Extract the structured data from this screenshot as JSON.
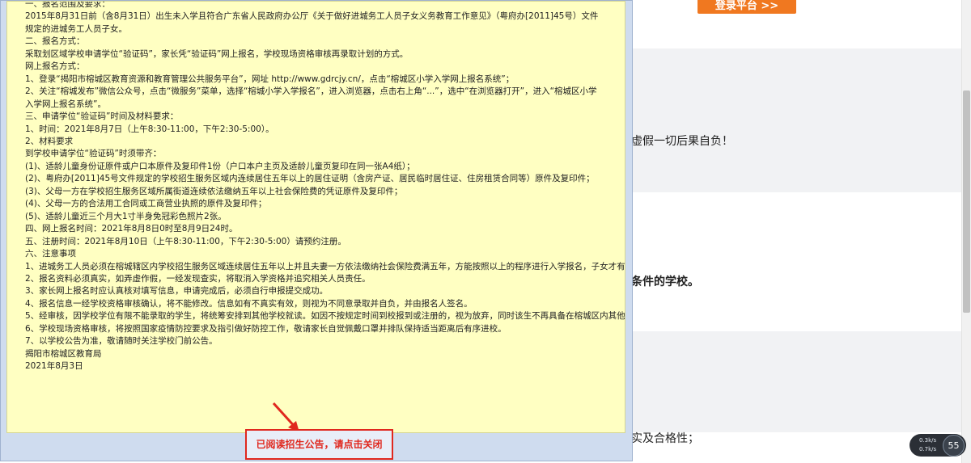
{
  "background": {
    "login_label": "登录平台 >>",
    "text1": "虚假一切后果自负！",
    "text2": "条件的学校。",
    "text3": "实及合格性；",
    "widget": {
      "line1": "0.3k/s",
      "line2": "0.7k/s",
      "value": "55"
    }
  },
  "notice": {
    "lines": [
      "一、报名范围及要求：",
      "2015年8月31日前（含8月31日）出生未入学且符合广东省人民政府办公厅《关于做好进城务工人员子女义务教育工作意见》（粤府办[2011]45号）文件",
      "规定的进城务工人员子女。",
      "二、报名方式：",
      "采取划区域学校申请学位“验证码”，家长凭“验证码”网上报名，学校现场资格审核再录取计划的方式。",
      "网上报名方式：",
      "1、登录“揭阳市榕城区教育资源和教育管理公共服务平台”，网址 http://www.gdrcjy.cn/，点击“榕城区小学入学网上报名系统”；",
      "2、关注“榕城发布”微信公众号，点击“微服务”菜单，选择“榕城小学入学报名”，进入浏览器，点击右上角“...”，选中“在浏览器打开”，进入“榕城区小学",
      "入学网上报名系统”。",
      "三、申请学位“验证码”时间及材料要求：",
      "1、时间：2021年8月7日（上午8:30-11:00，下午2:30-5:00）。",
      "2、材料要求",
      "到学校申请学位“验证码”时须带齐：",
      "(1)、适龄儿童身份证原件或户口本原件及复印件1份（户口本户主页及适龄儿童页复印在同一张A4纸）；",
      "(2)、粤府办[2011]45号文件规定的学校招生服务区域内连续居住五年以上的居住证明（含房产证、居民临时居住证、住房租赁合同等）原件及复印件；",
      "(3)、父母一方在学校招生服务区域所属街道连续依法缴纳五年以上社会保险费的凭证原件及复印件；",
      "(4)、父母一方的合法用工合同或工商营业执照的原件及复印件；",
      "(5)、适龄儿童近三个月大1寸半身免冠彩色照片2张。",
      "四、网上报名时间：2021年8月8日0时至8月9日24时。",
      "五、注册时间：2021年8月10日（上午8:30-11:00，下午2:30-5:00）请预约注册。",
      "六、注意事项",
      "1、进城务工人员必须在榕城辖区内学校招生服务区域连续居住五年以上并且夫妻一方依法缴纳社会保险费满五年，方能按照以上的程序进行入学报名，子女才有资格申请学位。",
      "2、报名资料必须真实，如弄虚作假，一经发现查实，将取消入学资格并追究相关人员责任。",
      "3、家长网上报名时应认真核对填写信息，申请完成后，必须自行申报提交成功。",
      "4、报名信息一经学校资格审核确认，将不能修改。信息如有不真实有效，则视为不同意录取并自负，并由报名人签名。",
      "5、经审核，因学校学位有限不能录取的学生，将统筹安排到其他学校就读。如因不按规定时间到校报到或注册的，视为放弃，同时该生不再具备在榕城区内其他公办学校报名计划的资格。",
      "6、学校现场资格审核，将按照国家疫情防控要求及指引做好防控工作，敬请家长自觉佩戴口罩并排队保持适当距离后有序进校。",
      "7、以学校公告为准，敬请随时关注学校门前公告。",
      "揭阳市榕城区教育局",
      "2021年8月3日"
    ]
  },
  "close_button": {
    "label": "已阅读招生公告，请点击关闭"
  }
}
